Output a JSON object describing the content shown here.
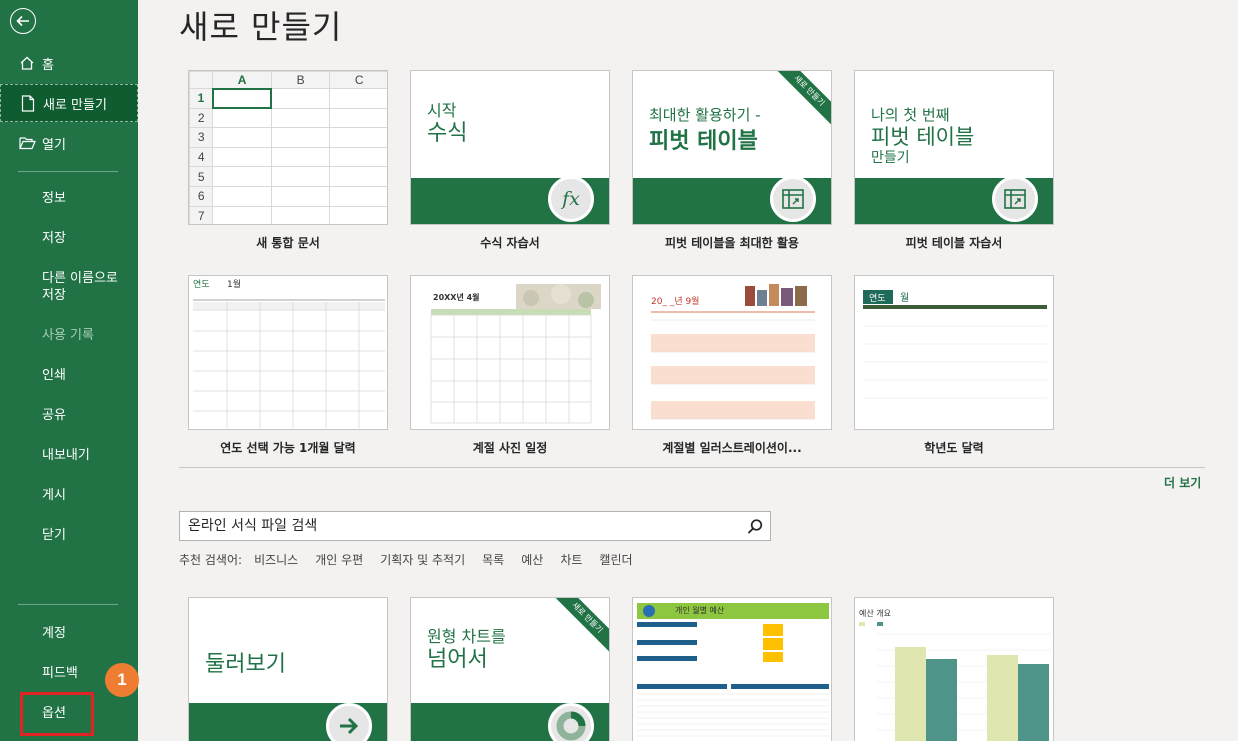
{
  "sidebar": {
    "items": [
      {
        "label": "홈"
      },
      {
        "label": "새로 만들기"
      },
      {
        "label": "열기"
      },
      {
        "label": "정보"
      },
      {
        "label": "저장"
      },
      {
        "label": "다른 이름으로 저장"
      },
      {
        "label": "사용 기록"
      },
      {
        "label": "인쇄"
      },
      {
        "label": "공유"
      },
      {
        "label": "내보내기"
      },
      {
        "label": "게시"
      },
      {
        "label": "닫기"
      }
    ],
    "bottom": [
      {
        "label": "계정"
      },
      {
        "label": "피드백"
      },
      {
        "label": "옵션"
      }
    ],
    "badge": "1"
  },
  "main": {
    "title": "새로 만들기",
    "templates_row1": [
      {
        "label": "새 통합 문서"
      },
      {
        "label": "수식 자습서",
        "line1": "시작",
        "line2": "수식"
      },
      {
        "label": "피벗 테이블을 최대한 활용",
        "line1": "최대한 활용하기 -",
        "line2": "피벗 테이블",
        "ribbon": "새로 만들기"
      },
      {
        "label": "피벗 테이블 자습서",
        "line1": "나의 첫 번째",
        "line2": "피벗 테이블",
        "line3": "만들기"
      }
    ],
    "templates_row2": [
      {
        "label": "연도 선택 가능 1개월 달력",
        "header1": "연도",
        "header2": "1월"
      },
      {
        "label": "계절 사진 일정",
        "header": "20XX년 4월"
      },
      {
        "label": "계절별 일러스트레이션이...",
        "header": "20_ _년 9월"
      },
      {
        "label": "학년도 달력",
        "header1": "연도",
        "header2": "월"
      }
    ],
    "more_link": "더 보기",
    "search": {
      "placeholder": "온라인 서식 파일 검색"
    },
    "suggest_label": "추천 검색어:",
    "suggestions": [
      "비즈니스",
      "개인 우편",
      "기획자 및 추적기",
      "목록",
      "예산",
      "차트",
      "캘린더"
    ],
    "templates_row3": [
      {
        "title": "둘러보기"
      },
      {
        "title1": "원형 차트를",
        "title2": "넘어서",
        "ribbon": "새로 만들기"
      },
      {
        "header": "개인 월별 예산"
      },
      {
        "header": "예산 개요"
      }
    ]
  },
  "colors": {
    "brand": "#217346",
    "accent": "#ef7d31",
    "highlight": "#e02424"
  }
}
